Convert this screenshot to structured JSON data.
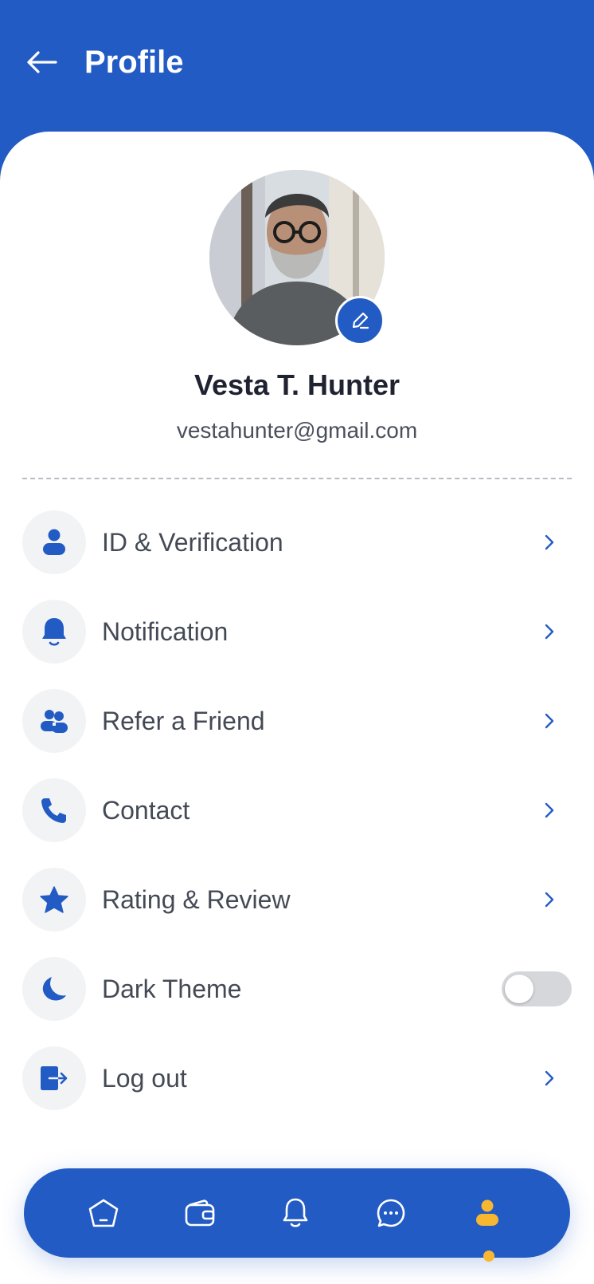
{
  "header": {
    "title": "Profile"
  },
  "profile": {
    "name": "Vesta T. Hunter",
    "email": "vestahunter@gmail.com"
  },
  "menu": {
    "items": [
      {
        "label": "ID & Verification",
        "icon": "user-icon"
      },
      {
        "label": "Notification",
        "icon": "bell-icon"
      },
      {
        "label": "Refer a Friend",
        "icon": "users-icon"
      },
      {
        "label": "Contact",
        "icon": "phone-icon"
      },
      {
        "label": "Rating & Review",
        "icon": "star-icon"
      },
      {
        "label": "Dark Theme",
        "icon": "moon-icon",
        "toggle": false
      },
      {
        "label": "Log out",
        "icon": "logout-icon"
      }
    ]
  },
  "bottom_nav": {
    "items": [
      "home-icon",
      "wallet-icon",
      "bell-icon",
      "chat-icon",
      "profile-icon"
    ],
    "active": "profile-icon"
  },
  "colors": {
    "primary": "#235BC4",
    "accent": "#F7B731",
    "icon_bg": "#F2F3F5",
    "text": "#444A55"
  }
}
